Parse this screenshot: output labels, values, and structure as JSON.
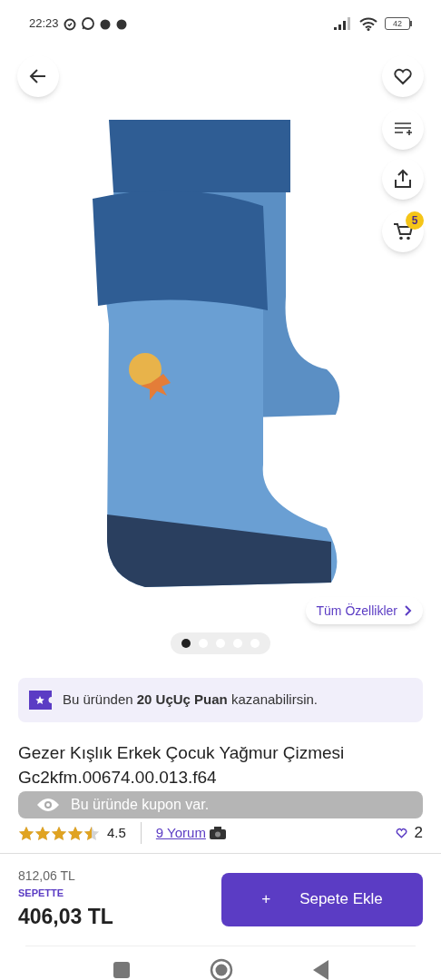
{
  "status_bar": {
    "time": "22:23",
    "battery": "42"
  },
  "gallery": {
    "cart_count": "5",
    "all_features": "Tüm Özellikler",
    "dots": [
      {
        "selected": true
      },
      {
        "selected": false
      },
      {
        "selected": false
      },
      {
        "selected": false
      },
      {
        "selected": false
      }
    ]
  },
  "points_banner": {
    "text": "Bu üründen **20 UçUç Puan** kazanabilirsin."
  },
  "product": {
    "title": "Gezer Kışlık Erkek Çocuk Yağmur Çizmesi Gc2kfm.00674.00.013.f64",
    "stars": 4.5,
    "rating": "4.5",
    "reviews": "9 Yorum",
    "likes": "2"
  },
  "toast": {
    "text": "Bu üründe kupon var."
  },
  "purchase": {
    "old_price": "812,06 TL",
    "label": "SEPETTE",
    "price": "406,03 TL",
    "plus": "+",
    "button": "Sepete Ekle"
  }
}
